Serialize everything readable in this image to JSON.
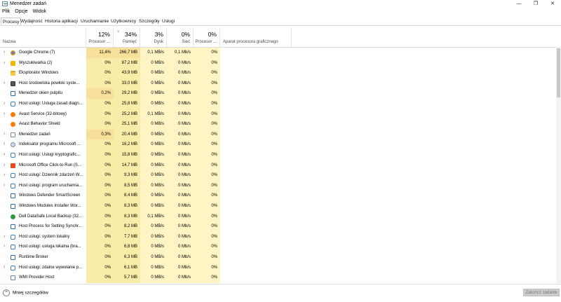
{
  "window": {
    "title": "Menedżer zadań",
    "minimize": "—",
    "maximize": "❐",
    "close": "✕"
  },
  "menu": [
    "Plik",
    "Opcje",
    "Widok"
  ],
  "tabs": [
    "Procesy",
    "Wydajność",
    "Historia aplikacji",
    "Uruchamianie",
    "Użytkownicy",
    "Szczegóły",
    "Usługi"
  ],
  "active_tab": "Procesy",
  "columns": {
    "name": {
      "label": "Nazwa"
    },
    "cpu": {
      "pct": "12%",
      "label": "Procesor ..."
    },
    "memory": {
      "pct": "34%",
      "label": "Pamięć"
    },
    "disk": {
      "pct": "3%",
      "label": "Dysk"
    },
    "network": {
      "pct": "0%",
      "label": "Sieć"
    },
    "gpu": {
      "pct": "0%",
      "label": "Procesor ..."
    },
    "gpu_engine": {
      "label": "Aparat procesora graficznego"
    }
  },
  "sort_arrow": "˅",
  "processes": [
    {
      "name": "Google Chrome (7)",
      "cpu": "11,4%",
      "mem": "266,7 MB",
      "disk": "0,1 MB/s",
      "net": "0,1 Mb/s",
      "gpu": "0%",
      "expand": true,
      "icon": "chrome-icon"
    },
    {
      "name": "Wyszukiwarka (2)",
      "cpu": "0%",
      "mem": "87,2 MB",
      "disk": "0 MB/s",
      "net": "0 Mb/s",
      "gpu": "0%",
      "expand": true,
      "icon": "search-app-icon"
    },
    {
      "name": "Eksplorator Windows",
      "cpu": "0%",
      "mem": "43,9 MB",
      "disk": "0 MB/s",
      "net": "0 Mb/s",
      "gpu": "0%",
      "expand": false,
      "icon": "folder-icon"
    },
    {
      "name": "Host środowiska powłoki syste...",
      "cpu": "0%",
      "mem": "33,0 MB",
      "disk": "0 MB/s",
      "net": "0 Mb/s",
      "gpu": "0%",
      "expand": true,
      "icon": "shell-host-icon"
    },
    {
      "name": "Menedżer okien pulpitu",
      "cpu": "0,2%",
      "mem": "29,2 MB",
      "disk": "0 MB/s",
      "net": "0 Mb/s",
      "gpu": "0%",
      "expand": false,
      "icon": "window-manager-icon"
    },
    {
      "name": "Host usługi: Usługa zasad diagn...",
      "cpu": "0%",
      "mem": "25,8 MB",
      "disk": "0 MB/s",
      "net": "0 Mb/s",
      "gpu": "0%",
      "expand": true,
      "icon": "gear-icon"
    },
    {
      "name": "Avast Service (32-bitowy)",
      "cpu": "0%",
      "mem": "25,2 MB",
      "disk": "0,1 MB/s",
      "net": "0 Mb/s",
      "gpu": "0%",
      "expand": true,
      "icon": "avast-icon"
    },
    {
      "name": "Avast Behavior Shield",
      "cpu": "0%",
      "mem": "25,1 MB",
      "disk": "0 MB/s",
      "net": "0 Mb/s",
      "gpu": "0%",
      "expand": false,
      "icon": "avast-icon"
    },
    {
      "name": "Menedżer zadań",
      "cpu": "0,3%",
      "mem": "20,4 MB",
      "disk": "0 MB/s",
      "net": "0 Mb/s",
      "gpu": "0%",
      "expand": true,
      "icon": "task-manager-icon"
    },
    {
      "name": "Indeksator programu Microsoft ...",
      "cpu": "0%",
      "mem": "16,2 MB",
      "disk": "0 MB/s",
      "net": "0 Mb/s",
      "gpu": "0%",
      "expand": true,
      "icon": "indexer-icon"
    },
    {
      "name": "Host usługi: Usługi kryptografic...",
      "cpu": "0%",
      "mem": "15,8 MB",
      "disk": "0 MB/s",
      "net": "0 Mb/s",
      "gpu": "0%",
      "expand": true,
      "icon": "gear-icon"
    },
    {
      "name": "Microsoft Office Click-to-Run (S...",
      "cpu": "0%",
      "mem": "14,7 MB",
      "disk": "0 MB/s",
      "net": "0 Mb/s",
      "gpu": "0%",
      "expand": true,
      "icon": "office-icon"
    },
    {
      "name": "Host usługi: Dziennik zdarzeń W...",
      "cpu": "0%",
      "mem": "9,3 MB",
      "disk": "0 MB/s",
      "net": "0 Mb/s",
      "gpu": "0%",
      "expand": true,
      "icon": "gear-icon"
    },
    {
      "name": "Host usługi: program uruchamia...",
      "cpu": "0%",
      "mem": "8,5 MB",
      "disk": "0 MB/s",
      "net": "0 Mb/s",
      "gpu": "0%",
      "expand": true,
      "icon": "gear-icon"
    },
    {
      "name": "Windows Defender SmartScreen",
      "cpu": "0%",
      "mem": "8,4 MB",
      "disk": "0 MB/s",
      "net": "0 Mb/s",
      "gpu": "0%",
      "expand": false,
      "icon": "window-app-icon"
    },
    {
      "name": "Windows Modules Installer Wor...",
      "cpu": "0%",
      "mem": "8,3 MB",
      "disk": "0 MB/s",
      "net": "0 Mb/s",
      "gpu": "0%",
      "expand": false,
      "icon": "window-app-icon"
    },
    {
      "name": "Dell DataSafe Local Backup (32...",
      "cpu": "0%",
      "mem": "8,3 MB",
      "disk": "0,1 MB/s",
      "net": "0 Mb/s",
      "gpu": "0%",
      "expand": false,
      "icon": "dell-icon"
    },
    {
      "name": "Host Process for Setting Synchr...",
      "cpu": "0%",
      "mem": "8,2 MB",
      "disk": "0 MB/s",
      "net": "0 Mb/s",
      "gpu": "0%",
      "expand": false,
      "icon": "window-app-icon"
    },
    {
      "name": "Host usługi: system lokalny",
      "cpu": "0%",
      "mem": "7,7 MB",
      "disk": "0 MB/s",
      "net": "0 Mb/s",
      "gpu": "0%",
      "expand": true,
      "icon": "gear-icon"
    },
    {
      "name": "Host usługi: usługa lokalna (bra...",
      "cpu": "0%",
      "mem": "6,8 MB",
      "disk": "0 MB/s",
      "net": "0 Mb/s",
      "gpu": "0%",
      "expand": true,
      "icon": "gear-icon"
    },
    {
      "name": "Runtime Broker",
      "cpu": "0%",
      "mem": "6,3 MB",
      "disk": "0 MB/s",
      "net": "0 Mb/s",
      "gpu": "0%",
      "expand": false,
      "icon": "window-app-icon"
    },
    {
      "name": "Host usługi: zdalne wywołanie p...",
      "cpu": "0%",
      "mem": "6,1 MB",
      "disk": "0 MB/s",
      "net": "0 Mb/s",
      "gpu": "0%",
      "expand": true,
      "icon": "gear-icon"
    },
    {
      "name": "WMI Provider Host",
      "cpu": "0%",
      "mem": "5,7 MB",
      "disk": "0 MB/s",
      "net": "0 Mb/s",
      "gpu": "0%",
      "expand": false,
      "icon": "wmi-icon"
    }
  ],
  "footer": {
    "fewer_details": "Mniej szczegółów",
    "fewer_icon": "^",
    "end_task": "Zakończ zadanie"
  },
  "colors": {
    "heat_light": "#fff4c4",
    "heat_mid": "#f9eca8",
    "heat_strong": "#f9e09a"
  }
}
